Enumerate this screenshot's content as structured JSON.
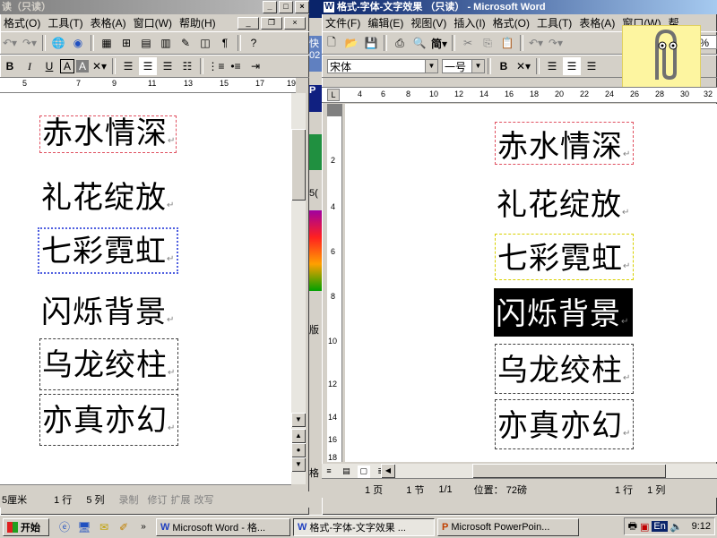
{
  "left_window": {
    "title": "读（只读）",
    "menu": [
      "格式(O)",
      "工具(T)",
      "表格(A)",
      "窗口(W)",
      "帮助(H)"
    ],
    "paragraphs": [
      "赤水情深",
      "礼花绽放",
      "七彩霓虹",
      "闪烁背景",
      "乌龙绞柱",
      "亦真亦幻"
    ],
    "status": {
      "position": "5厘米",
      "line": "1 行",
      "col": "5 列",
      "rec": "录制",
      "trk": "修订",
      "ext": "扩展",
      "ovr": "改写"
    }
  },
  "middle_strip": {
    "texts": [
      "快",
      "02",
      "P",
      "版",
      "5(",
      "格"
    ]
  },
  "right_window": {
    "title": "格式-字体-文字效果 （只读） - Microsoft Word",
    "menu": [
      "文件(F)",
      "编辑(E)",
      "视图(V)",
      "插入(I)",
      "格式(O)",
      "工具(T)",
      "表格(A)",
      "窗口(W)",
      "帮"
    ],
    "font_name": "宋体",
    "font_size": "一号",
    "zoom": "00%",
    "ruler_numbers": [
      "4",
      "6",
      "8",
      "10",
      "12",
      "14",
      "16",
      "18",
      "20",
      "22",
      "24",
      "26",
      "28",
      "30",
      "32"
    ],
    "vruler_numbers": [
      "2",
      "4",
      "6",
      "8",
      "10",
      "12",
      "14",
      "16",
      "18"
    ],
    "paragraphs": [
      "赤水情深",
      "礼花绽放",
      "七彩霓虹",
      "闪烁背景",
      "乌龙绞柱",
      "亦真亦幻"
    ],
    "status": {
      "page": "1 页",
      "section": "1 节",
      "pages": "1/1",
      "position": "位置： 72磅",
      "line": "1 行",
      "col": "1 列"
    }
  },
  "taskbar": {
    "start": "开始",
    "tasks": [
      "Microsoft Word - 格...",
      "格式-字体-文字效果 ...",
      "Microsoft PowerPoin..."
    ],
    "lang": "En",
    "time": "9:12"
  },
  "colors": {
    "title_active": "#0a246a",
    "title_inactive": "#808080",
    "face": "#d4d0c8",
    "desktop": "#008080"
  }
}
